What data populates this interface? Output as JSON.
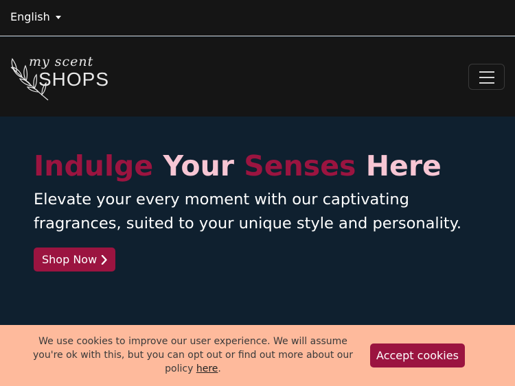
{
  "topbar": {
    "language": "English"
  },
  "navbar": {
    "logo_script": "my scent",
    "logo_text": "SHOPS"
  },
  "hero": {
    "title_parts": [
      "Indulge",
      "Your",
      "Senses",
      "Here"
    ],
    "subtitle": "Elevate your every moment with our captivating fragrances, suited to your unique style and personality.",
    "cta_label": "Shop Now"
  },
  "cookie": {
    "message": "We use cookies to improve our user experience. We will assume you're ok with this, but you can opt out or find out more about our policy",
    "link_text": "here",
    "period": ".",
    "accept_label": "Accept cookies"
  },
  "colors": {
    "accent": "#9b1440",
    "accent_light": "#f7c6d4",
    "hero_bg": "#0f202f",
    "header_bg": "#151515",
    "cookie_bg": "#feba9c"
  }
}
